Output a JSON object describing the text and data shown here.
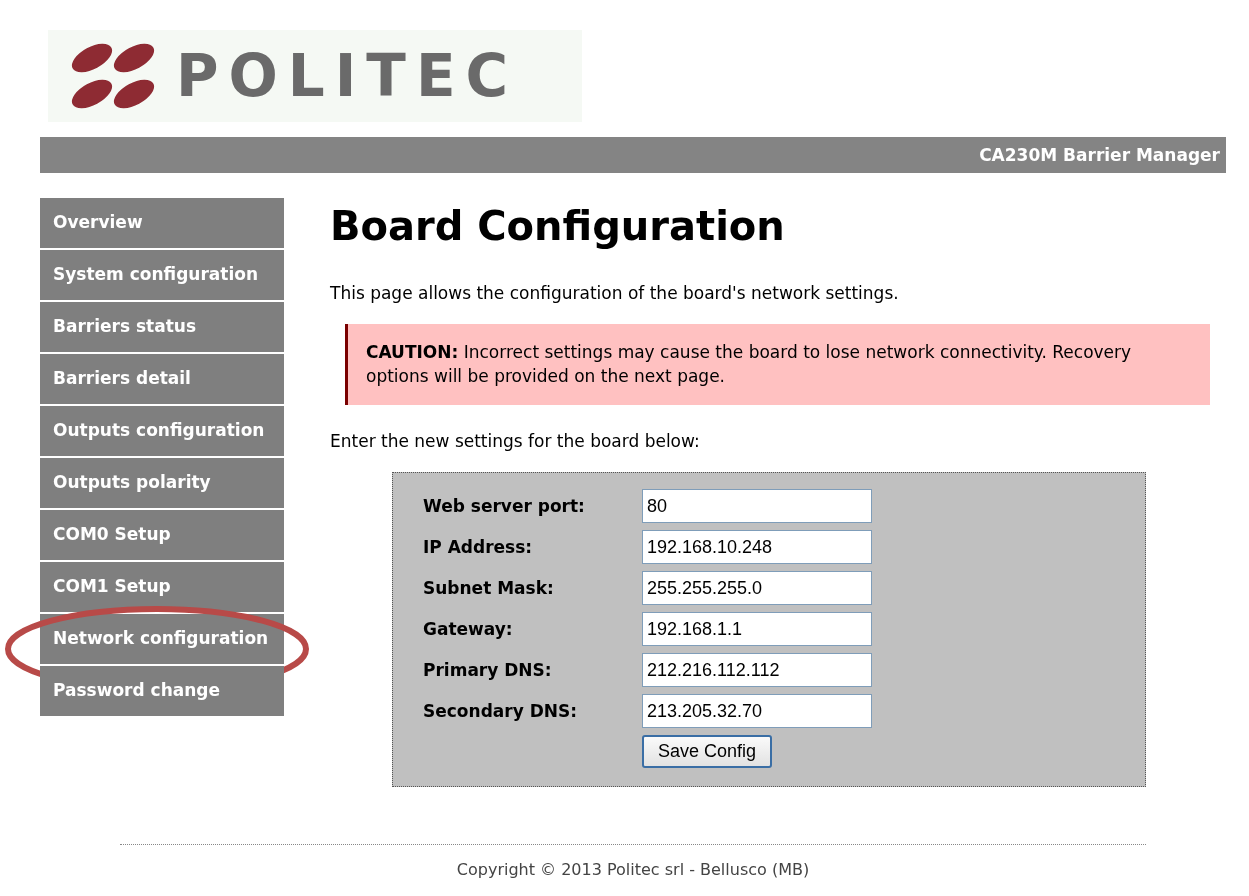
{
  "logo": {
    "text": "POLITEC"
  },
  "header": {
    "title": "CA230M Barrier Manager"
  },
  "sidebar": {
    "items": [
      {
        "label": "Overview",
        "highlighted": false
      },
      {
        "label": "System configuration",
        "highlighted": false
      },
      {
        "label": "Barriers status",
        "highlighted": false
      },
      {
        "label": "Barriers detail",
        "highlighted": false
      },
      {
        "label": "Outputs configuration",
        "highlighted": false
      },
      {
        "label": "Outputs polarity",
        "highlighted": false
      },
      {
        "label": "COM0 Setup",
        "highlighted": false
      },
      {
        "label": "COM1 Setup",
        "highlighted": false
      },
      {
        "label": "Network configuration",
        "highlighted": true
      },
      {
        "label": "Password change",
        "highlighted": false
      }
    ]
  },
  "main": {
    "heading": "Board Configuration",
    "intro": "This page allows the configuration of the board's network settings.",
    "caution": "**CAUTION:** Incorrect settings may cause the board to lose network connectivity. Recovery options will be provided on the next page.",
    "prompt": "Enter the new settings for the board below:",
    "form": {
      "fields": [
        {
          "label": "Web server port:",
          "value": "80"
        },
        {
          "label": "IP Address:",
          "value": "192.168.10.248"
        },
        {
          "label": "Subnet Mask:",
          "value": "255.255.255.0"
        },
        {
          "label": "Gateway:",
          "value": "192.168.1.1"
        },
        {
          "label": "Primary DNS:",
          "value": "212.216.112.112"
        },
        {
          "label": "Secondary DNS:",
          "value": "213.205.32.70"
        }
      ],
      "button": "Save Config"
    }
  },
  "footer": {
    "copyright": "Copyright © 2013 Politec srl - Bellusco (MB)"
  }
}
